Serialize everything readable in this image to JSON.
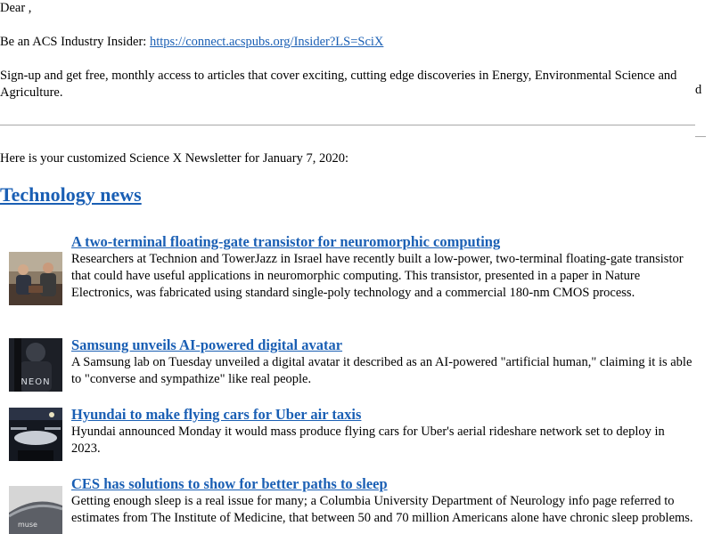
{
  "greeting": "Dear ,",
  "insider": {
    "prefix": "Be an ACS Industry Insider: ",
    "link_text": "https://connect.acspubs.org/Insider?LS=SciX"
  },
  "signup_text": "Sign-up and get free, monthly access to articles that cover exciting, cutting edge discoveries in Energy, Environmental Science and Agriculture.",
  "stray_char": "d",
  "intro_text": "Here is your customized Science X Newsletter for January 7, 2020:",
  "section_title": "Technology news",
  "articles": [
    {
      "title": "A two-terminal floating-gate transistor for neuromorphic computing",
      "body": "Researchers at Technion and TowerJazz in Israel have recently built a low-power, two-terminal floating-gate transistor that could have useful applications in neuromorphic computing. This transistor, presented in a paper in Nature Electronics, was fabricated using standard single-poly technology and a commercial 180-nm CMOS process.",
      "thumb": "two-researchers-photo"
    },
    {
      "title": "Samsung unveils AI-powered digital avatar",
      "body": "A Samsung lab on Tuesday unveiled a digital avatar it described as an AI-powered \"artificial human,\" claiming it is able to \"converse and sympathize\" like real people.",
      "thumb": "neon-avatar-photo",
      "thumb_text": "NEON"
    },
    {
      "title": "Hyundai to make flying cars for Uber air taxis",
      "body": "Hyundai announced Monday it would mass produce flying cars for Uber's aerial rideshare network set to deploy in 2023.",
      "thumb": "flying-car-photo"
    },
    {
      "title": "CES has solutions to show for better paths to sleep",
      "body": "Getting enough sleep is a real issue for many; a Columbia University Department of Neurology info page referred to estimates from The Institute of Medicine, that between 50 and 70 million Americans alone have chronic sleep problems.",
      "thumb": "sleep-device-photo",
      "thumb_text": "muse"
    }
  ]
}
